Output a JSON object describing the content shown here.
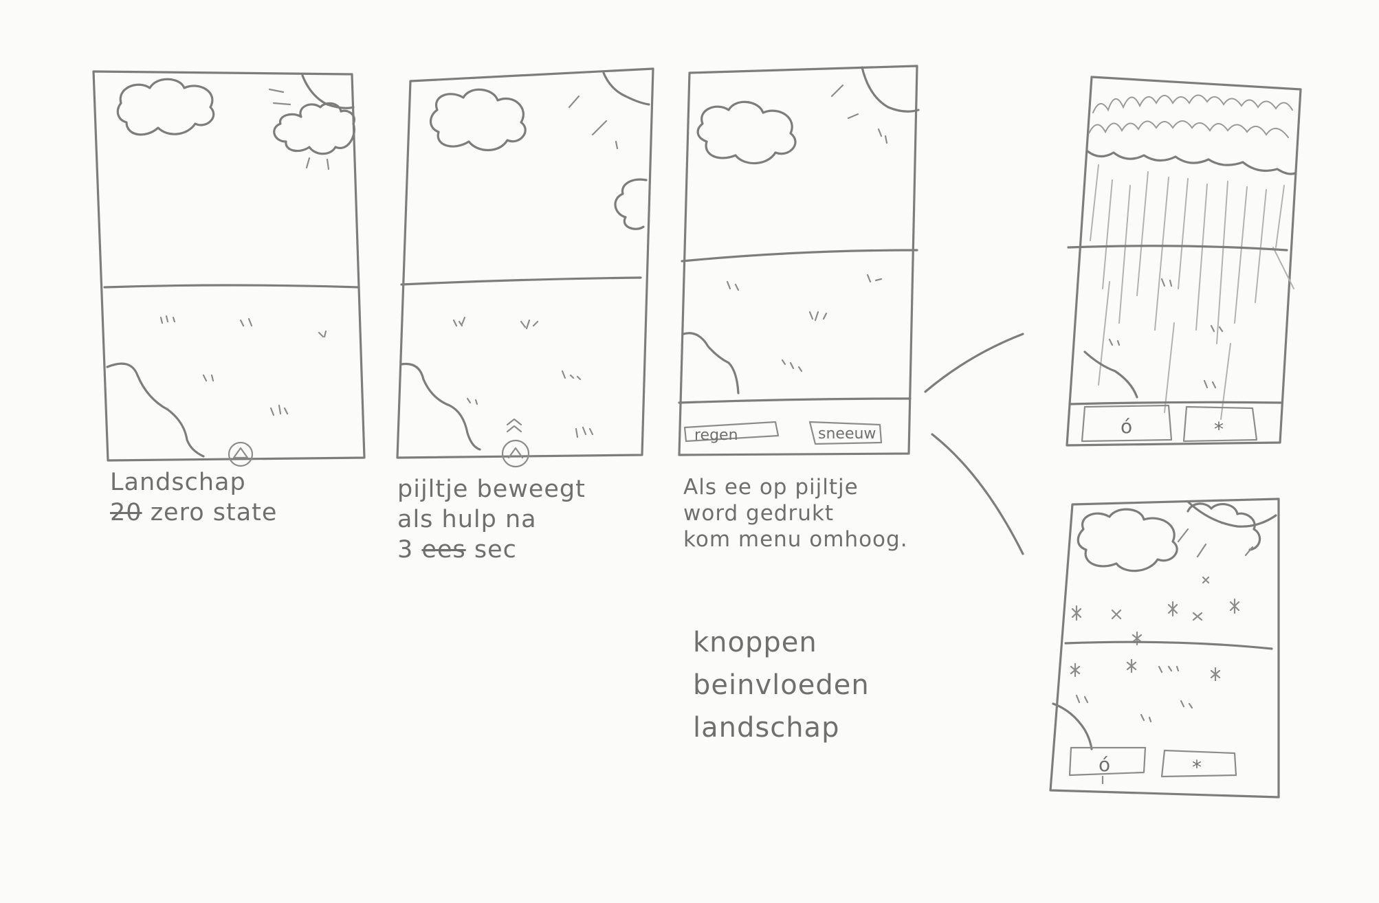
{
  "frames": [
    {
      "id": "frame-1",
      "caption_lines": [
        "Landschap"
      ],
      "caption_struck": "20",
      "caption_after_struck": "zero state",
      "handle": "^"
    },
    {
      "id": "frame-2",
      "caption_lines": [
        "pijltje beweegt",
        "als hulp na"
      ],
      "caption_tail_prefix": "3",
      "caption_tail_struck": "ees",
      "caption_tail_suffix": "sec",
      "handle": "^"
    },
    {
      "id": "frame-3",
      "caption_lines": [
        "Als ee op pijltje",
        "word gedrukt",
        "kom menu omhoog."
      ],
      "menu_buttons": [
        "regen",
        "sneeuw"
      ]
    },
    {
      "id": "frame-rain",
      "menu_buttons": [
        "ó",
        "*"
      ]
    },
    {
      "id": "frame-snow",
      "menu_buttons": [
        "ó",
        "*"
      ]
    }
  ],
  "note_lines": [
    "knoppen",
    "beinvloeden",
    "landschap"
  ]
}
